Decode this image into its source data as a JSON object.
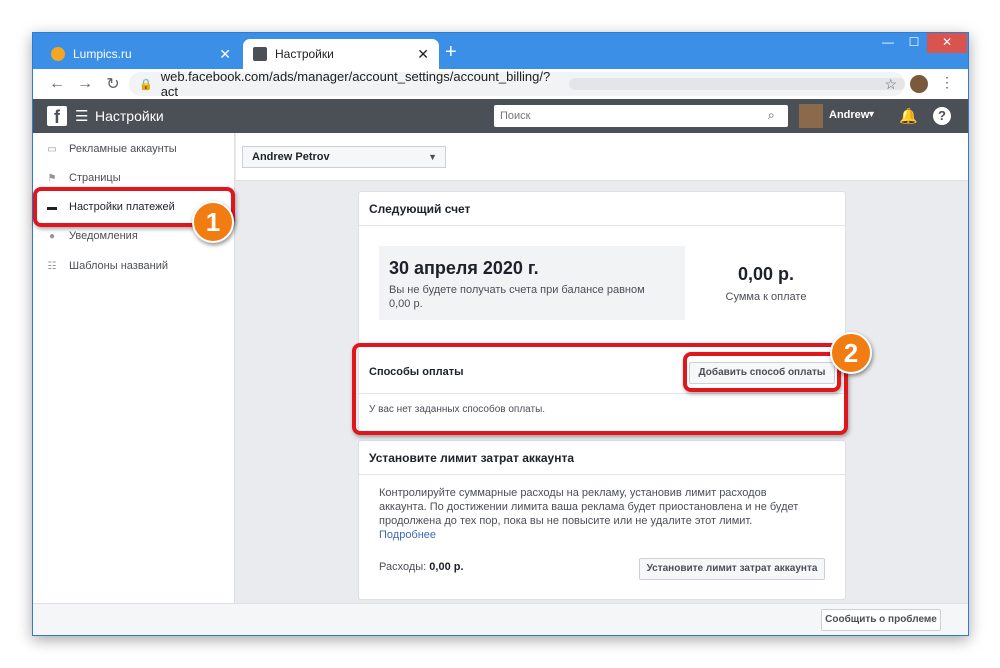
{
  "browser": {
    "tabs": [
      {
        "label": "Lumpics.ru",
        "close": "✕"
      },
      {
        "label": "Настройки",
        "close": "✕"
      }
    ],
    "new_tab": "+",
    "url": "web.facebook.com/ads/manager/account_settings/account_billing/?act",
    "window_controls": {
      "minimize": "—",
      "maximize": "☐",
      "close": "✕"
    }
  },
  "header": {
    "logo": "f",
    "title": "Настройки",
    "search_placeholder": "Поиск",
    "user": "Andrew"
  },
  "sidebar": {
    "items": [
      {
        "label": "Рекламные аккаунты"
      },
      {
        "label": "Страницы"
      },
      {
        "label": "Настройки платежей"
      },
      {
        "label": "Уведомления"
      },
      {
        "label": "Шаблоны названий"
      }
    ]
  },
  "account_selector": {
    "value": "Andrew Petrov"
  },
  "next_invoice": {
    "title": "Следующий счет",
    "date": "30 апреля 2020 г.",
    "note": "Вы не будете получать счета при балансе равном 0,00 р.",
    "amount": "0,00 р.",
    "amount_label": "Сумма к оплате"
  },
  "payment_methods": {
    "title": "Способы оплаты",
    "add_button": "Добавить способ оплаты",
    "empty_text": "У вас нет заданных способов оплаты."
  },
  "spend_limit": {
    "title": "Установите лимит затрат аккаунта",
    "description": "Контролируйте суммарные расходы на рекламу, установив лимит расходов аккаунта. По достижении лимита ваша реклама будет приостановлена и не будет продолжена до тех пор, пока вы не повысите или не удалите этот лимит.",
    "more_link": "Подробнее",
    "spend_label": "Расходы:",
    "spend_value": "0,00 р.",
    "button": "Установите лимит затрат аккаунта"
  },
  "footer": {
    "report_button": "Сообщить о проблеме"
  },
  "annotations": {
    "marker_1": "1",
    "marker_2": "2"
  },
  "colors": {
    "highlight": "#e0161d",
    "marker": "#f07c12",
    "fb_bar": "#4b4f56",
    "link": "#4267b2"
  }
}
